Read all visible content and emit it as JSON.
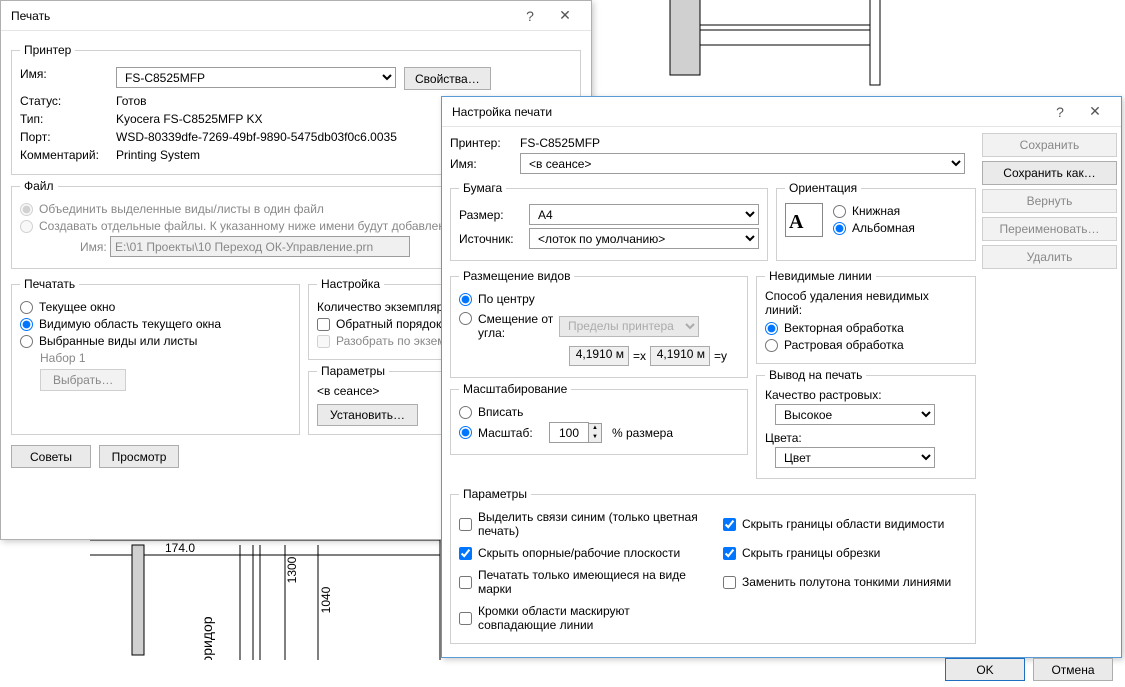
{
  "d1": {
    "title": "Печать",
    "printer": {
      "legend": "Принтер",
      "name_label": "Имя:",
      "name_value": "FS-C8525MFP",
      "props_btn": "Свойства…",
      "status_label": "Статус:",
      "status_value": "Готов",
      "type_label": "Тип:",
      "type_value": "Kyocera FS-C8525MFP KX",
      "port_label": "Порт:",
      "port_value": "WSD-80339dfe-7269-49bf-9890-5475db03f0c6.0035",
      "comment_label": "Комментарий:",
      "comment_value": "Printing System"
    },
    "file": {
      "legend": "Файл",
      "combine": "Объединить выделенные виды/листы в один файл",
      "separate": "Создавать отдельные файлы. К указанному ниже имени будут добавлен",
      "name_label": "Имя:",
      "name_value": "E:\\01 Проекты\\10 Переход ОК-Управление.prn"
    },
    "print_range": {
      "legend": "Печатать",
      "current": "Текущее окно",
      "visible": "Видимую область текущего окна",
      "selected": "Выбранные виды или листы",
      "set_label": "Набор 1",
      "select_btn": "Выбрать…"
    },
    "settings": {
      "legend": "Настройка",
      "copies_label": "Количество экземпляр",
      "reverse": "Обратный порядок",
      "collate": "Разобрать по экзем"
    },
    "params": {
      "legend": "Параметры",
      "in_session": "<в сеансе>",
      "set_btn": "Установить…"
    },
    "tips_btn": "Советы",
    "preview_btn": "Просмотр",
    "ok_btn": "ОК"
  },
  "d2": {
    "title": "Настройка печати",
    "printer_label": "Принтер:",
    "printer_value": "FS-C8525MFP",
    "name_label": "Имя:",
    "name_value": "<в сеансе>",
    "buttons": {
      "save": "Сохранить",
      "saveas": "Сохранить как…",
      "revert": "Вернуть",
      "rename": "Переименовать…",
      "delete": "Удалить"
    },
    "paper": {
      "legend": "Бумага",
      "size_label": "Размер:",
      "size_value": "A4",
      "source_label": "Источник:",
      "source_value": "<лоток по умолчанию>"
    },
    "orient": {
      "legend": "Ориентация",
      "portrait": "Книжная",
      "landscape": "Альбомная",
      "icon_letter": "A"
    },
    "placement": {
      "legend": "Размещение видов",
      "center": "По центру",
      "offset": "Смещение от угла:",
      "limits_value": "Пределы принтера",
      "x_value": "4,1910 м",
      "x_suffix": "=x",
      "y_value": "4,1910 м",
      "y_suffix": "=y"
    },
    "hidden": {
      "legend": "Невидимые линии",
      "method_label": "Способ удаления невидимых линий:",
      "vector": "Векторная обработка",
      "raster": "Растровая обработка"
    },
    "zoom": {
      "legend": "Масштабирование",
      "fit": "Вписать",
      "scale": "Масштаб:",
      "value": "100",
      "suffix": "% размера"
    },
    "output": {
      "legend": "Вывод на печать",
      "quality_label": "Качество растровых:",
      "quality_value": "Высокое",
      "colors_label": "Цвета:",
      "colors_value": "Цвет"
    },
    "params": {
      "legend": "Параметры",
      "blue": "Выделить связи синим (только цветная печать)",
      "hide_ref": "Скрыть опорные/рабочие плоскости",
      "only_marks": "Печатать только имеющиеся на виде марки",
      "mask_edges": "Кромки области маскируют совпадающие линии",
      "hide_view": "Скрыть границы области видимости",
      "hide_crop": "Скрыть границы обрезки",
      "thin_lines": "Заменить полутона тонкими линиями"
    },
    "ok_btn": "OK",
    "cancel_btn": "Отмена"
  },
  "drawing": {
    "dim1": "174.0",
    "dim2": "1300",
    "dim3": "1040",
    "room": "оридор"
  }
}
